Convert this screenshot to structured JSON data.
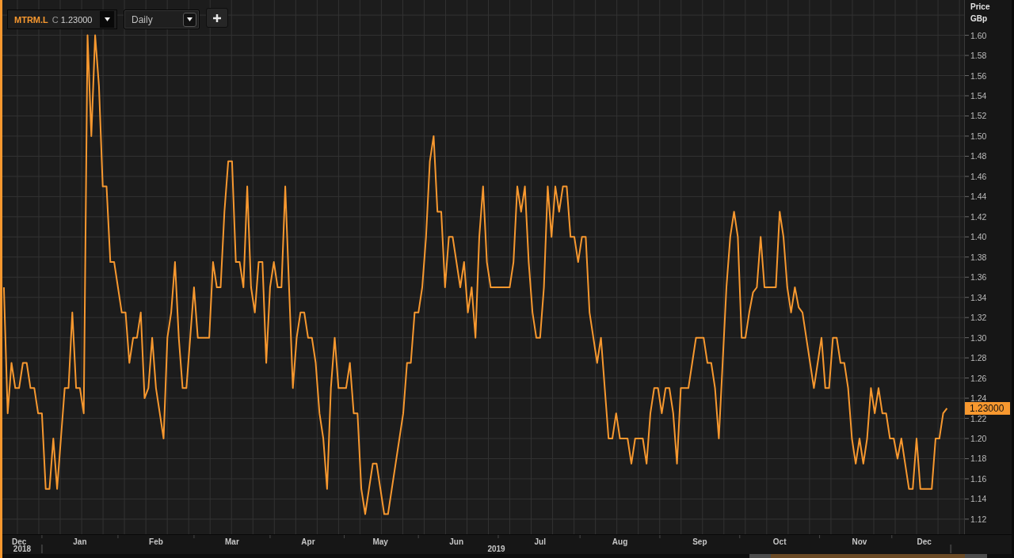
{
  "toolbar": {
    "instrument": {
      "symbol": "MTRM.L",
      "price_type": "C",
      "price": "1.23000"
    },
    "interval": {
      "value": "Daily"
    }
  },
  "chart": {
    "y_unit": "GBp",
    "current_value": "1.23000",
    "year_labels": [
      "2018",
      "2019"
    ],
    "chart_data": {
      "type": "line",
      "ylabel": "Price",
      "grid": true,
      "ylim": [
        1.105,
        1.635
      ],
      "categories": [
        null,
        null,
        null,
        null,
        "Dec",
        null,
        null,
        null,
        null,
        null,
        null,
        null,
        null,
        null,
        null,
        null,
        null,
        null,
        null,
        null,
        "Jan",
        null,
        null,
        null,
        null,
        null,
        null,
        null,
        null,
        null,
        null,
        null,
        null,
        null,
        null,
        null,
        null,
        null,
        null,
        null,
        "Feb",
        null,
        null,
        null,
        null,
        null,
        null,
        null,
        null,
        null,
        null,
        null,
        null,
        null,
        null,
        null,
        null,
        null,
        null,
        null,
        "Mar",
        null,
        null,
        null,
        null,
        null,
        null,
        null,
        null,
        null,
        null,
        null,
        null,
        null,
        null,
        null,
        null,
        null,
        null,
        null,
        "Apr",
        null,
        null,
        null,
        null,
        null,
        null,
        null,
        null,
        null,
        null,
        null,
        null,
        null,
        null,
        null,
        null,
        null,
        null,
        "May",
        null,
        null,
        null,
        null,
        null,
        null,
        null,
        null,
        null,
        null,
        null,
        null,
        null,
        null,
        null,
        null,
        null,
        null,
        null,
        "Jun",
        null,
        null,
        null,
        null,
        null,
        null,
        null,
        null,
        null,
        null,
        null,
        null,
        null,
        null,
        null,
        null,
        null,
        null,
        null,
        null,
        null,
        "Jul",
        null,
        null,
        null,
        null,
        null,
        null,
        null,
        null,
        null,
        null,
        null,
        null,
        null,
        null,
        null,
        null,
        null,
        null,
        null,
        null,
        "Aug",
        null,
        null,
        null,
        null,
        null,
        null,
        null,
        null,
        null,
        null,
        null,
        null,
        null,
        null,
        null,
        null,
        null,
        null,
        null,
        null,
        "Sep",
        null,
        null,
        null,
        null,
        null,
        null,
        null,
        null,
        null,
        null,
        null,
        null,
        null,
        null,
        null,
        null,
        null,
        null,
        null,
        null,
        "Oct",
        null,
        null,
        null,
        null,
        null,
        null,
        null,
        null,
        null,
        null,
        null,
        null,
        null,
        null,
        null,
        null,
        null,
        null,
        null,
        null,
        "Nov",
        null,
        null,
        null,
        null,
        null,
        null,
        null,
        null,
        null,
        null,
        null,
        null,
        null,
        null,
        null,
        null,
        "Dec",
        null,
        null,
        null,
        null,
        null,
        null
      ],
      "yticks": [
        {
          "value": 1.12,
          "label": "1.12"
        },
        {
          "value": 1.14,
          "label": "1.14"
        },
        {
          "value": 1.16,
          "label": "1.16"
        },
        {
          "value": 1.18,
          "label": "1.18"
        },
        {
          "value": 1.2,
          "label": "1.20"
        },
        {
          "value": 1.22,
          "label": "1.22"
        },
        {
          "value": 1.24,
          "label": "1.24"
        },
        {
          "value": 1.26,
          "label": "1.26"
        },
        {
          "value": 1.28,
          "label": "1.28"
        },
        {
          "value": 1.3,
          "label": "1.30"
        },
        {
          "value": 1.32,
          "label": "1.32"
        },
        {
          "value": 1.34,
          "label": "1.34"
        },
        {
          "value": 1.36,
          "label": "1.36"
        },
        {
          "value": 1.38,
          "label": "1.38"
        },
        {
          "value": 1.4,
          "label": "1.40"
        },
        {
          "value": 1.42,
          "label": "1.42"
        },
        {
          "value": 1.44,
          "label": "1.44"
        },
        {
          "value": 1.46,
          "label": "1.46"
        },
        {
          "value": 1.48,
          "label": "1.48"
        },
        {
          "value": 1.5,
          "label": "1.50"
        },
        {
          "value": 1.52,
          "label": "1.52"
        },
        {
          "value": 1.54,
          "label": "1.54"
        },
        {
          "value": 1.56,
          "label": "1.56"
        },
        {
          "value": 1.58,
          "label": "1.58"
        },
        {
          "value": 1.6,
          "label": "1.60"
        }
      ],
      "series": [
        {
          "color": "#f7982f",
          "values": [
            1.35,
            1.225,
            1.275,
            1.25,
            1.25,
            1.275,
            1.275,
            1.25,
            1.25,
            1.225,
            1.225,
            1.15,
            1.15,
            1.2,
            1.15,
            1.2,
            1.25,
            1.25,
            1.325,
            1.25,
            1.25,
            1.225,
            1.6,
            1.5,
            1.6,
            1.55,
            1.45,
            1.45,
            1.375,
            1.375,
            1.35,
            1.325,
            1.325,
            1.275,
            1.3,
            1.3,
            1.325,
            1.24,
            1.25,
            1.3,
            1.25,
            1.225,
            1.2,
            1.3,
            1.325,
            1.375,
            1.3,
            1.25,
            1.25,
            1.3,
            1.35,
            1.3,
            1.3,
            1.3,
            1.3,
            1.375,
            1.35,
            1.35,
            1.425,
            1.475,
            1.475,
            1.375,
            1.375,
            1.35,
            1.45,
            1.35,
            1.325,
            1.375,
            1.375,
            1.275,
            1.35,
            1.375,
            1.35,
            1.35,
            1.45,
            1.35,
            1.25,
            1.3,
            1.325,
            1.325,
            1.3,
            1.3,
            1.275,
            1.225,
            1.2,
            1.15,
            1.25,
            1.3,
            1.25,
            1.25,
            1.25,
            1.275,
            1.225,
            1.225,
            1.15,
            1.125,
            1.15,
            1.175,
            1.175,
            1.15,
            1.125,
            1.125,
            1.15,
            1.175,
            1.2,
            1.225,
            1.275,
            1.275,
            1.325,
            1.325,
            1.35,
            1.4,
            1.475,
            1.5,
            1.425,
            1.425,
            1.35,
            1.4,
            1.4,
            1.375,
            1.35,
            1.375,
            1.325,
            1.35,
            1.3,
            1.4,
            1.45,
            1.375,
            1.35,
            1.35,
            1.35,
            1.35,
            1.35,
            1.35,
            1.375,
            1.45,
            1.425,
            1.45,
            1.375,
            1.325,
            1.3,
            1.3,
            1.35,
            1.45,
            1.4,
            1.45,
            1.425,
            1.45,
            1.45,
            1.4,
            1.4,
            1.375,
            1.4,
            1.4,
            1.325,
            1.3,
            1.275,
            1.3,
            1.25,
            1.2,
            1.2,
            1.225,
            1.2,
            1.2,
            1.2,
            1.175,
            1.2,
            1.2,
            1.2,
            1.175,
            1.225,
            1.25,
            1.25,
            1.225,
            1.25,
            1.25,
            1.225,
            1.175,
            1.25,
            1.25,
            1.25,
            1.275,
            1.3,
            1.3,
            1.3,
            1.275,
            1.275,
            1.25,
            1.2,
            1.275,
            1.35,
            1.4,
            1.425,
            1.4,
            1.3,
            1.3,
            1.325,
            1.345,
            1.35,
            1.4,
            1.35,
            1.35,
            1.35,
            1.35,
            1.425,
            1.4,
            1.35,
            1.325,
            1.35,
            1.33,
            1.325,
            1.3,
            1.275,
            1.25,
            1.275,
            1.3,
            1.25,
            1.25,
            1.3,
            1.3,
            1.275,
            1.275,
            1.25,
            1.2,
            1.175,
            1.2,
            1.175,
            1.2,
            1.25,
            1.225,
            1.25,
            1.225,
            1.225,
            1.2,
            1.2,
            1.18,
            1.2,
            1.175,
            1.15,
            1.15,
            1.2,
            1.15,
            1.15,
            1.15,
            1.15,
            1.2,
            1.2,
            1.225,
            1.23
          ]
        }
      ]
    }
  }
}
